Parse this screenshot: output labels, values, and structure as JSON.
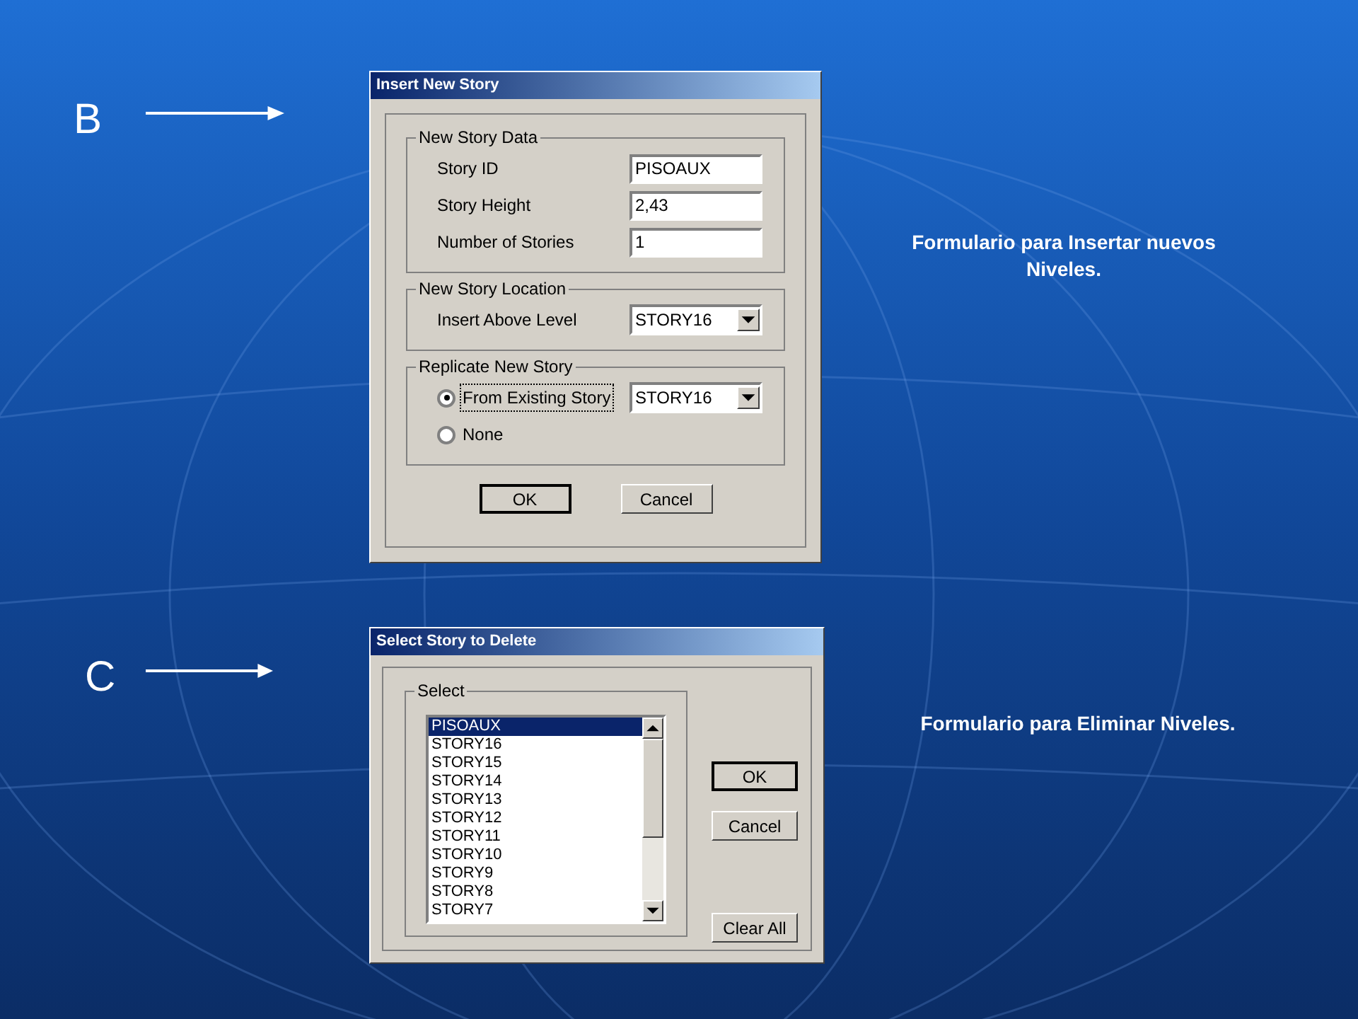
{
  "sections": [
    {
      "marker": "B",
      "caption": "Formulario para Insertar nuevos Niveles.",
      "dialog": {
        "kind": "insert",
        "title": "Insert New Story",
        "groups": [
          {
            "legend": "New Story Data",
            "rows": [
              {
                "kind": "text",
                "label": "Story ID",
                "value": "PISOAUX"
              },
              {
                "kind": "text",
                "label": "Story Height",
                "value": "2,43"
              },
              {
                "kind": "text",
                "label": "Number of Stories",
                "value": "1"
              }
            ]
          },
          {
            "legend": "New Story Location",
            "rows": [
              {
                "kind": "dropdown",
                "label": "Insert Above Level",
                "value": "STORY16"
              }
            ]
          },
          {
            "legend": "Replicate New Story",
            "rows": [
              {
                "kind": "radio",
                "label": "From Existing Story",
                "selected": true,
                "focused": true,
                "value": "STORY16"
              },
              {
                "kind": "radio",
                "label": "None",
                "selected": false,
                "focused": false
              }
            ]
          }
        ],
        "buttons": [
          {
            "label": "OK",
            "default": true
          },
          {
            "label": "Cancel",
            "default": false
          }
        ]
      }
    },
    {
      "marker": "C",
      "caption": "Formulario para Eliminar Niveles.",
      "dialog": {
        "kind": "delete",
        "title": "Select Story to Delete",
        "legend": "Select",
        "items": [
          {
            "label": "PISOAUX",
            "selected": true
          },
          {
            "label": "STORY16",
            "selected": false
          },
          {
            "label": "STORY15",
            "selected": false
          },
          {
            "label": "STORY14",
            "selected": false
          },
          {
            "label": "STORY13",
            "selected": false
          },
          {
            "label": "STORY12",
            "selected": false
          },
          {
            "label": "STORY11",
            "selected": false
          },
          {
            "label": "STORY10",
            "selected": false
          },
          {
            "label": "STORY9",
            "selected": false
          },
          {
            "label": "STORY8",
            "selected": false
          },
          {
            "label": "STORY7",
            "selected": false
          }
        ],
        "buttons": [
          {
            "label": "OK",
            "default": true
          },
          {
            "label": "Cancel",
            "default": false
          },
          {
            "label": "Clear All",
            "default": false
          }
        ]
      }
    }
  ]
}
